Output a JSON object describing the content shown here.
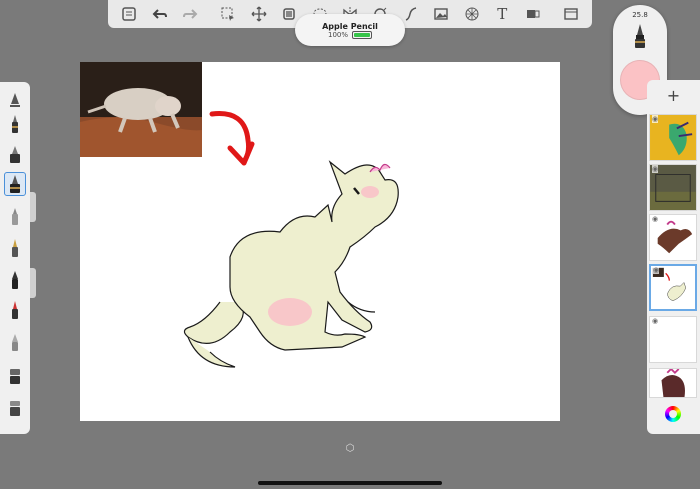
{
  "pencil_status": {
    "title": "Apple Pencil",
    "battery": "100%",
    "battery_level": 1.0
  },
  "brush_puck": {
    "size": "25.8",
    "color": "#fbc2c5"
  },
  "toolbar": {
    "items": [
      "gallery-icon",
      "undo-icon",
      "redo-icon",
      "selection-icon",
      "transform-icon",
      "crop-icon",
      "lasso-icon",
      "symmetry-icon",
      "ruler-icon",
      "stroke-icon",
      "image-icon",
      "perspective-icon",
      "text-icon",
      "layer-icon",
      "fullscreen-icon"
    ],
    "text_tool_label": "T"
  },
  "brushes": [
    "brush-1",
    "brush-2",
    "brush-3",
    "brush-4",
    "brush-5",
    "brush-6",
    "brush-7",
    "brush-8",
    "brush-9",
    "brush-10",
    "brush-11"
  ],
  "layers": {
    "add_label": "+",
    "count": 6
  }
}
